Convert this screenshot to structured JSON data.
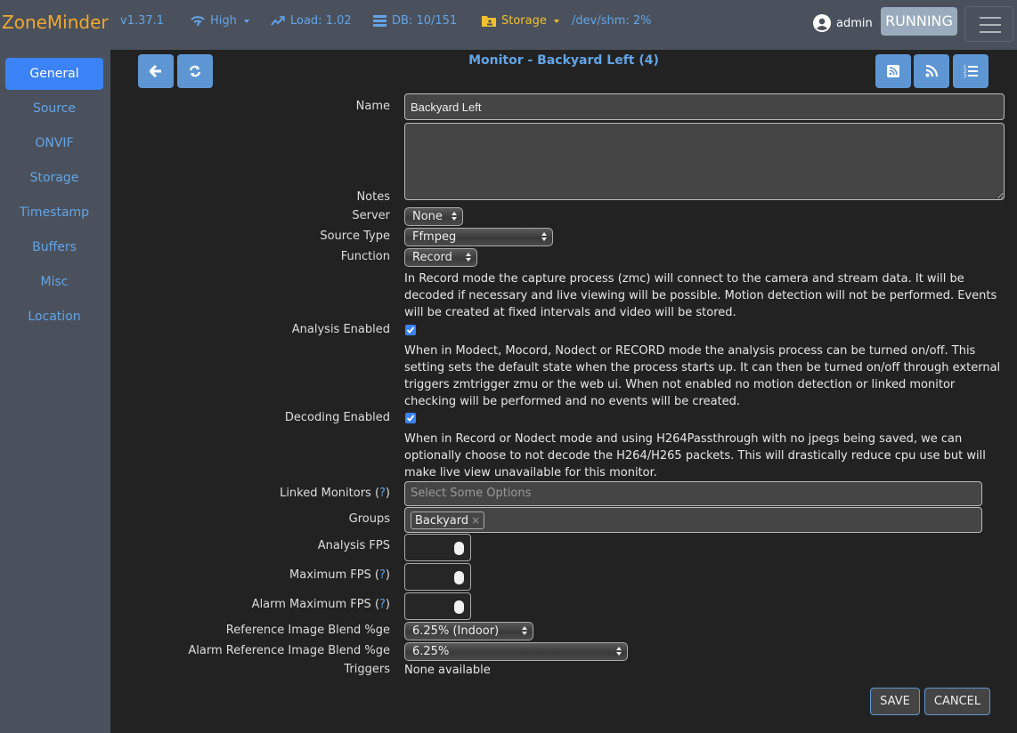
{
  "topbar": {
    "brand": "ZoneMinder",
    "version": "v1.37.1",
    "bandwidth": "High",
    "load": "Load: 1.02",
    "db": "DB: 10/151",
    "storage": "Storage",
    "shm": "/dev/shm: 2%",
    "user": "admin",
    "status": "RUNNING"
  },
  "sidebar": {
    "items": [
      {
        "label": "General",
        "active": true
      },
      {
        "label": "Source"
      },
      {
        "label": "ONVIF"
      },
      {
        "label": "Storage"
      },
      {
        "label": "Timestamp"
      },
      {
        "label": "Buffers"
      },
      {
        "label": "Misc"
      },
      {
        "label": "Location"
      }
    ]
  },
  "main": {
    "title": "Monitor - Backyard Left (4)",
    "form": {
      "name_label": "Name",
      "name_value": "Backyard Left",
      "notes_label": "Notes",
      "notes_value": "",
      "server_label": "Server",
      "server_value": "None",
      "source_type_label": "Source Type",
      "source_type_value": "Ffmpeg",
      "function_label": "Function",
      "function_value": "Record",
      "function_help": "In Record mode the capture process (zmc) will connect to the camera and stream data. It will be decoded if necessary and live viewing will be possible. Motion detection will not be performed. Events will be created at fixed intervals and video will be stored.",
      "analysis_enabled_label": "Analysis Enabled",
      "analysis_enabled": true,
      "analysis_help": "When in Modect, Mocord, Nodect or RECORD mode the analysis process can be turned on/off. This setting sets the default state when the process starts up. It can then be turned on/off through external triggers zmtrigger zmu or the web ui. When not enabled no motion detection or linked monitor checking will be performed and no events will be created.",
      "decoding_enabled_label": "Decoding Enabled",
      "decoding_enabled": true,
      "decoding_help": "When in Record or Nodect mode and using H264Passthrough with no jpegs being saved, we can optionally choose to not decode the H264/H265 packets. This will drastically reduce cpu use but will make live view unavailable for this monitor.",
      "linked_monitors_label": "Linked Monitors (",
      "help_mark": "?",
      "help_close": ")",
      "linked_monitors_placeholder": "Select Some Options",
      "groups_label": "Groups",
      "groups_chips": [
        "Backyard"
      ],
      "chip_remove": "×",
      "analysis_fps_label": "Analysis FPS",
      "analysis_fps_value": "",
      "max_fps_label": "Maximum FPS (",
      "max_fps_value": "",
      "alarm_max_fps_label": "Alarm Maximum FPS (",
      "alarm_max_fps_value": "",
      "ref_blend_label": "Reference Image Blend %ge",
      "ref_blend_value": "6.25% (Indoor)",
      "alarm_ref_blend_label": "Alarm Reference Image Blend %ge",
      "alarm_ref_blend_value": "6.25%",
      "triggers_label": "Triggers",
      "triggers_value": "None available"
    },
    "buttons": {
      "save": "SAVE",
      "cancel": "CANCEL"
    }
  },
  "colors": {
    "accent": "#63a4e6",
    "brand": "#f0a830",
    "active_tab": "#3b82f6",
    "running_badge": "#9aabbd"
  }
}
